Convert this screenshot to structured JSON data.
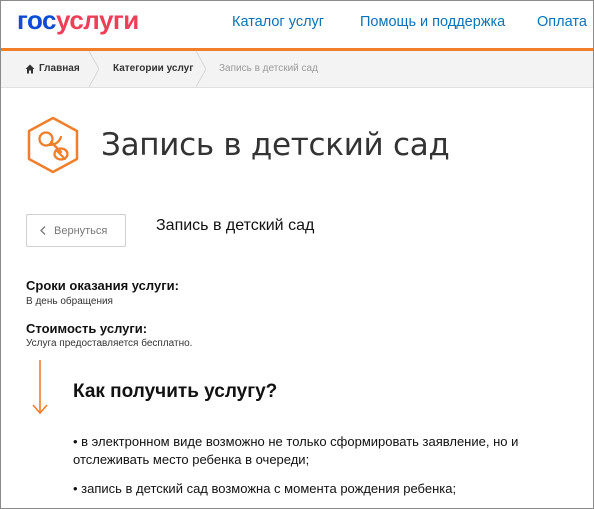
{
  "header": {
    "logo_part1": "гос",
    "logo_part2": "услуги",
    "nav": [
      "Каталог услуг",
      "Помощь и поддержка",
      "Оплата"
    ]
  },
  "breadcrumb": {
    "items": [
      "Главная",
      "Категории услуг",
      "Запись в детский сад"
    ]
  },
  "page": {
    "title": "Запись в детский сад",
    "back_label": "Вернуться",
    "subtitle": "Запись в детский сад",
    "terms_label": "Сроки оказания услуги:",
    "terms_value": "В день обращения",
    "cost_label": "Стоимость услуги:",
    "cost_value": "Услуга предоставляется бесплатно.",
    "how_title": "Как получить услугу?",
    "bullets": [
      "• в электронном виде возможно не только сформировать заявление, но и отслеживать место ребенка в очереди;",
      "• запись в детский сад возможна с момента рождения ребенка;"
    ]
  },
  "colors": {
    "brand_blue": "#0d4cd3",
    "brand_red": "#ee3f58",
    "accent_orange": "#f07e2a",
    "link_blue": "#0c72b7"
  },
  "icons": [
    "home-icon",
    "pacifier-icon",
    "chevron-left-icon",
    "arrow-down-icon"
  ]
}
